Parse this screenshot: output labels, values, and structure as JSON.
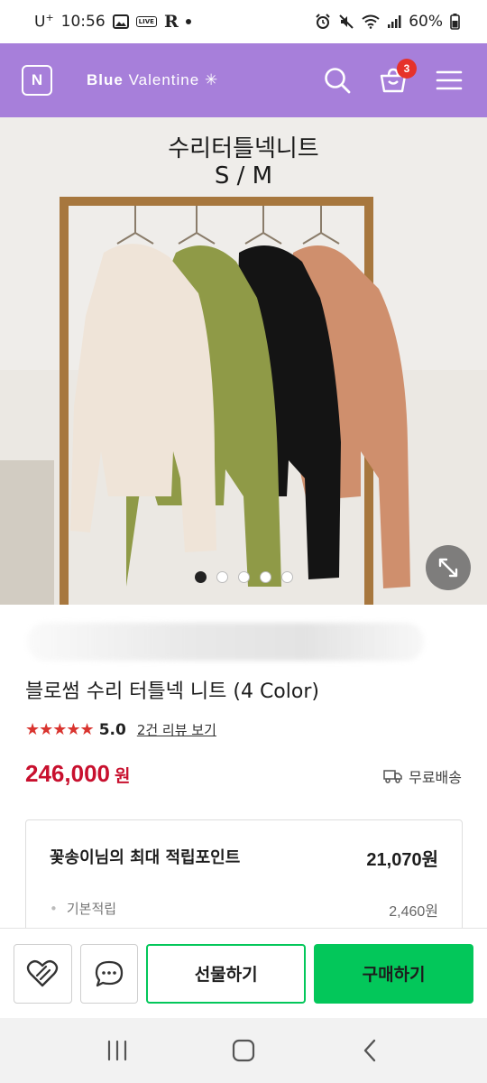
{
  "status_bar": {
    "carrier": "U",
    "carrier_sup": "+",
    "time": "10:56",
    "live_label": "LIVE",
    "app_letter": "R",
    "battery": "60%"
  },
  "header": {
    "logo_letter": "N",
    "brand_bold": "Blue",
    "brand_light": "Valentine",
    "brand_mark": "✳",
    "cart_count": "3",
    "icons": [
      "search-icon",
      "cart-icon",
      "menu-icon"
    ],
    "accent_color": "#a77fda"
  },
  "product_image": {
    "title_line1": "수리터틀넥니트",
    "title_line2": "S / M",
    "carousel_count": 5,
    "carousel_active_index": 0,
    "sweater_colors": [
      "#efe4d8",
      "#8f9a47",
      "#141414",
      "#cf8f6d"
    ]
  },
  "product": {
    "name": "블로썸 수리 터틀넥 니트 (4 Color)",
    "rating": "5.0",
    "review_link": "2건 리뷰 보기",
    "price": "246,000",
    "price_unit": "원",
    "shipping": "무료배송",
    "price_color": "#c8102e"
  },
  "points": {
    "title": "꽃송이님의 최대 적립포인트",
    "value": "21,070원",
    "sub_label": "기본적립",
    "sub_value": "2,460원"
  },
  "actions": {
    "gift_label": "선물하기",
    "buy_label": "구매하기",
    "buy_color": "#03c75a"
  }
}
